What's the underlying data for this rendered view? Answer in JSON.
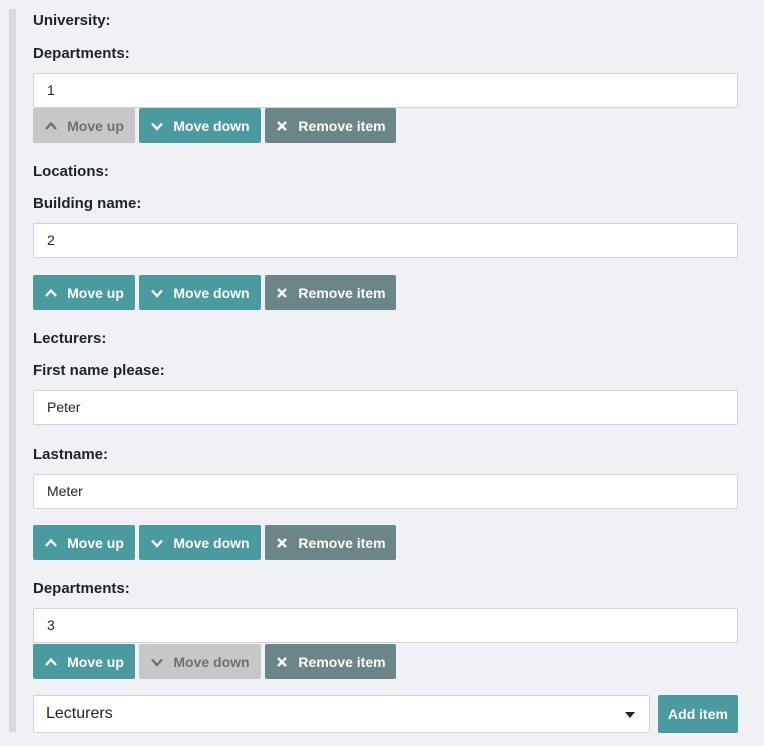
{
  "university": {
    "label": "University:",
    "departments_label": "Departments:",
    "departments_value": "1",
    "buttons_1": {
      "move_up": "Move up",
      "move_down": "Move down",
      "remove": "Remove item"
    },
    "locations_label": "Locations:",
    "building_label": "Building name:",
    "building_value": "2",
    "buttons_2": {
      "move_up": "Move up",
      "move_down": "Move down",
      "remove": "Remove item"
    },
    "lecturers_label": "Lecturers:",
    "first_name_label": "First name please:",
    "first_name_value": "Peter",
    "last_name_label": "Lastname:",
    "last_name_value": "Meter",
    "buttons_3": {
      "move_up": "Move up",
      "move_down": "Move down",
      "remove": "Remove item"
    },
    "departments2_label": "Departments:",
    "departments2_value": "3",
    "buttons_4": {
      "move_up": "Move up",
      "move_down": "Move down",
      "remove": "Remove item"
    }
  },
  "add_section": {
    "select_value": "Lecturers",
    "add_button": "Add item"
  },
  "colors": {
    "accent": "#4a9aa0",
    "remove": "#6c8588",
    "disabled": "#c6c7c9",
    "background": "#f0f1f5"
  },
  "icons": {
    "up": "chevron-up-icon",
    "down": "chevron-down-icon",
    "remove": "close-icon",
    "caret": "caret-down-icon"
  }
}
